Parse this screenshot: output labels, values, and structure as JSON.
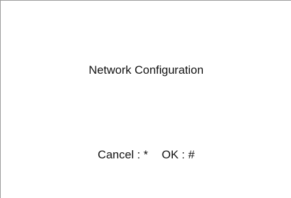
{
  "screen": {
    "title": "Network Configuration",
    "softkeys": {
      "cancel_label": "Cancel : *",
      "ok_label": "OK : #"
    }
  }
}
